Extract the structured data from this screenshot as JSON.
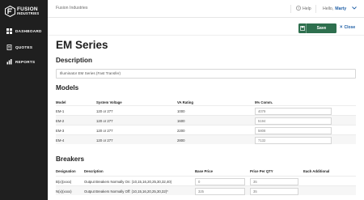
{
  "brand": {
    "line1": "FUSION",
    "line2": "INDUSTRIES"
  },
  "sidebar": {
    "items": [
      {
        "label": "DASHBOARD",
        "icon": "dashboard-icon"
      },
      {
        "label": "QUOTES",
        "icon": "quotes-icon"
      },
      {
        "label": "REPORTS",
        "icon": "reports-icon"
      }
    ]
  },
  "topbar": {
    "company": "Fusion Industries",
    "help": "Help",
    "greeting": "Hello,",
    "user_name": "Marty"
  },
  "actions": {
    "save_label": "Save",
    "close_label": "Close"
  },
  "page": {
    "title": "EM Series",
    "description_heading": "Description",
    "description_value": "Illuminator EM Series (Fast Transfer)",
    "models_heading": "Models",
    "breakers_heading": "Breakers"
  },
  "models_table": {
    "columns": [
      "Model",
      "System Voltage",
      "VA Rating",
      "5% Comm."
    ],
    "rows": [
      {
        "model": "EM-1",
        "voltage": "120 or 277",
        "va": "1000",
        "comm": "4079"
      },
      {
        "model": "EM-2",
        "voltage": "120 or 277",
        "va": "1600",
        "comm": "5194"
      },
      {
        "model": "EM-3",
        "voltage": "120 or 277",
        "va": "2200",
        "comm": "5808"
      },
      {
        "model": "EM-4",
        "voltage": "120 or 277",
        "va": "2800",
        "comm": "7132"
      }
    ]
  },
  "breakers_table": {
    "columns": [
      "Designation",
      "Description",
      "Base Price",
      "Price Per QTY",
      "Each Additional"
    ],
    "rows": [
      {
        "designation": "B(x)(xxxx)",
        "description": "Output Breakers Normally On: (10,15,16,20,25,30,32,40)",
        "base_price": "0",
        "price_per_qty": "35"
      },
      {
        "designation": "N(x)(xxxx)",
        "description": "Output Breakers Normally Off: (10,15,16,20,25,30,32)*",
        "base_price": "325",
        "price_per_qty": "35"
      }
    ]
  },
  "colors": {
    "sidebar_bg": "#1f1f1f",
    "save_button": "#2e6f4e",
    "link_blue": "#1f5fa6"
  }
}
